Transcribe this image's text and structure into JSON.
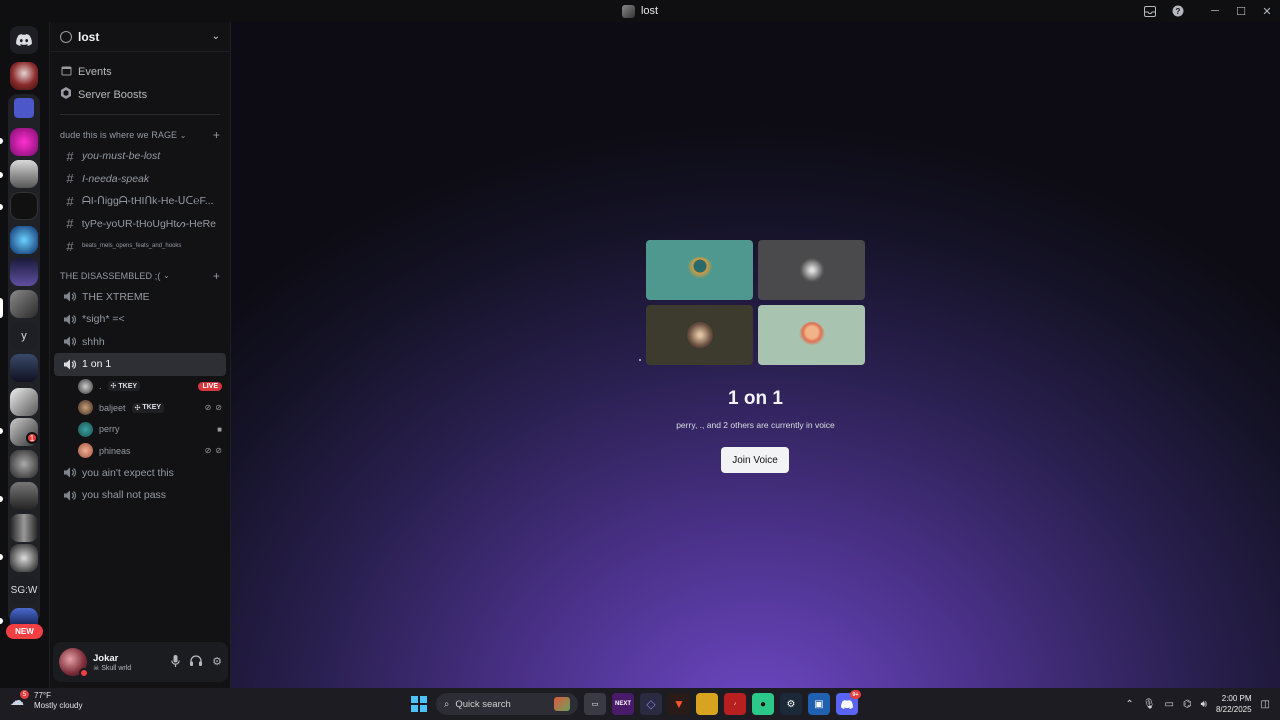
{
  "window": {
    "title": "lost"
  },
  "guilds": {
    "text_guild_1": "y",
    "text_guild_2": "SG:W",
    "new_label": "NEW",
    "badge_count": "1"
  },
  "server": {
    "name": "lost"
  },
  "menu": {
    "events": "Events",
    "server_boosts": "Server Boosts"
  },
  "categories": [
    {
      "name": "dude this is where we RAGE",
      "channels": [
        {
          "name": "you-must-be-lost"
        },
        {
          "name": "I-needa-speak"
        },
        {
          "name": "ᗩI-ᑎiggᗩ-tHIᑎk-He-ᑌᑕ℮F..."
        },
        {
          "name": "tyPe-yoUR-tHoUgHtᔕ-HeRe"
        },
        {
          "name": "beats_mels_opens_feats_and_hooks"
        }
      ]
    },
    {
      "name": "THE DISASSEMBLED ;(",
      "channels": [
        {
          "name": "THE XTREME"
        },
        {
          "name": "*sigh* =<"
        },
        {
          "name": "shhh"
        },
        {
          "name": "1 on 1"
        },
        {
          "name": "you ain't expect this"
        },
        {
          "name": "you shall not pass"
        }
      ]
    }
  ],
  "voice_users": [
    {
      "name": ".",
      "tag": "TKEY",
      "live": "LIVE"
    },
    {
      "name": "baljeet",
      "tag": "TKEY"
    },
    {
      "name": "perry"
    },
    {
      "name": "phineas"
    }
  ],
  "user": {
    "name": "Jokar",
    "status": "Skull wrld"
  },
  "voice_panel": {
    "title": "1 on 1",
    "subtitle": "perry, ., and 2 others are currently in voice",
    "join_label": "Join Voice"
  },
  "taskbar": {
    "weather_temp": "77°F",
    "weather_desc": "Mostly cloudy",
    "weather_badge": "5",
    "search_placeholder": "Quick search",
    "discord_badge": "9+",
    "next_label": "NEXT",
    "time": "2:00 PM",
    "date": "8/22/2025"
  },
  "colors": {
    "accent": "#5865f2",
    "live_red": "#da373c",
    "dnd_red": "#f23f43",
    "bg_purple": "#6d48c4"
  }
}
